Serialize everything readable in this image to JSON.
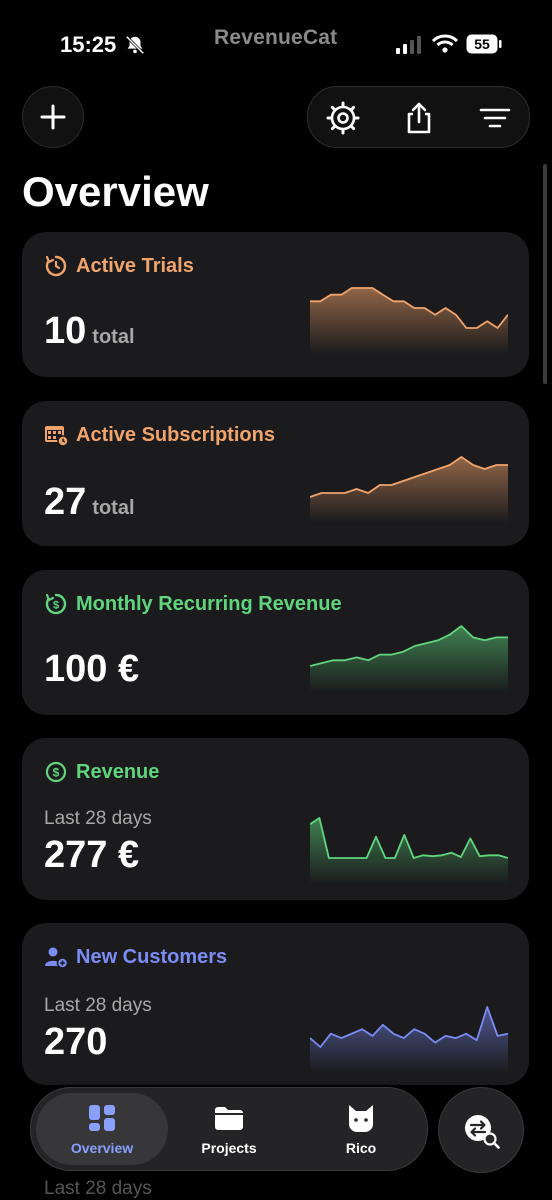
{
  "status_bar": {
    "time": "15:25",
    "brand": "RevenueCat",
    "battery": "55"
  },
  "page": {
    "title": "Overview"
  },
  "colors": {
    "orange": "#f2a46b",
    "green": "#5fd67e",
    "blue": "#7b8cf5"
  },
  "cards": [
    {
      "name": "active-trials",
      "title": "Active Trials",
      "value": "10",
      "unit": "total",
      "icon": "timer-icon",
      "chart_data": {
        "type": "area",
        "values": [
          6,
          6,
          7,
          7,
          8,
          8,
          8,
          7,
          6,
          6,
          5,
          5,
          4,
          5,
          4,
          2,
          2,
          3,
          2,
          4
        ]
      }
    },
    {
      "name": "active-subscriptions",
      "title": "Active Subscriptions",
      "value": "27",
      "unit": "total",
      "icon": "calendar-icon",
      "chart_data": {
        "type": "area",
        "values": [
          20,
          21,
          21,
          21,
          22,
          21,
          23,
          23,
          24,
          25,
          26,
          27,
          28,
          30,
          28,
          27,
          28,
          28
        ]
      }
    },
    {
      "name": "monthly-recurring-revenue",
      "title": "Monthly Recurring Revenue",
      "value": "100 €",
      "icon": "cycle-dollar-icon",
      "chart_data": {
        "type": "area",
        "values": [
          75,
          76,
          77,
          77,
          78,
          77,
          79,
          79,
          80,
          82,
          83,
          84,
          86,
          89,
          85,
          84,
          85,
          85
        ]
      }
    },
    {
      "name": "revenue",
      "title": "Revenue",
      "subtitle": "Last 28 days",
      "value": "277 €",
      "icon": "dollar-icon",
      "chart_data": {
        "type": "area",
        "values": [
          38,
          45,
          0,
          0,
          0,
          0,
          0,
          24,
          0,
          0,
          26,
          0,
          3,
          2,
          3,
          6,
          1,
          22,
          2,
          3,
          3,
          0
        ]
      }
    },
    {
      "name": "new-customers",
      "title": "New Customers",
      "subtitle": "Last 28 days",
      "value": "270",
      "icon": "add-user-icon",
      "chart_data": {
        "type": "area",
        "values": [
          8,
          4,
          10,
          8,
          10,
          12,
          9,
          14,
          10,
          8,
          12,
          10,
          6,
          9,
          8,
          10,
          7,
          22,
          9,
          10
        ]
      }
    }
  ],
  "nav": {
    "overview": "Overview",
    "projects": "Projects",
    "rico": "Rico"
  },
  "footer_ghost": "Last 28 days"
}
